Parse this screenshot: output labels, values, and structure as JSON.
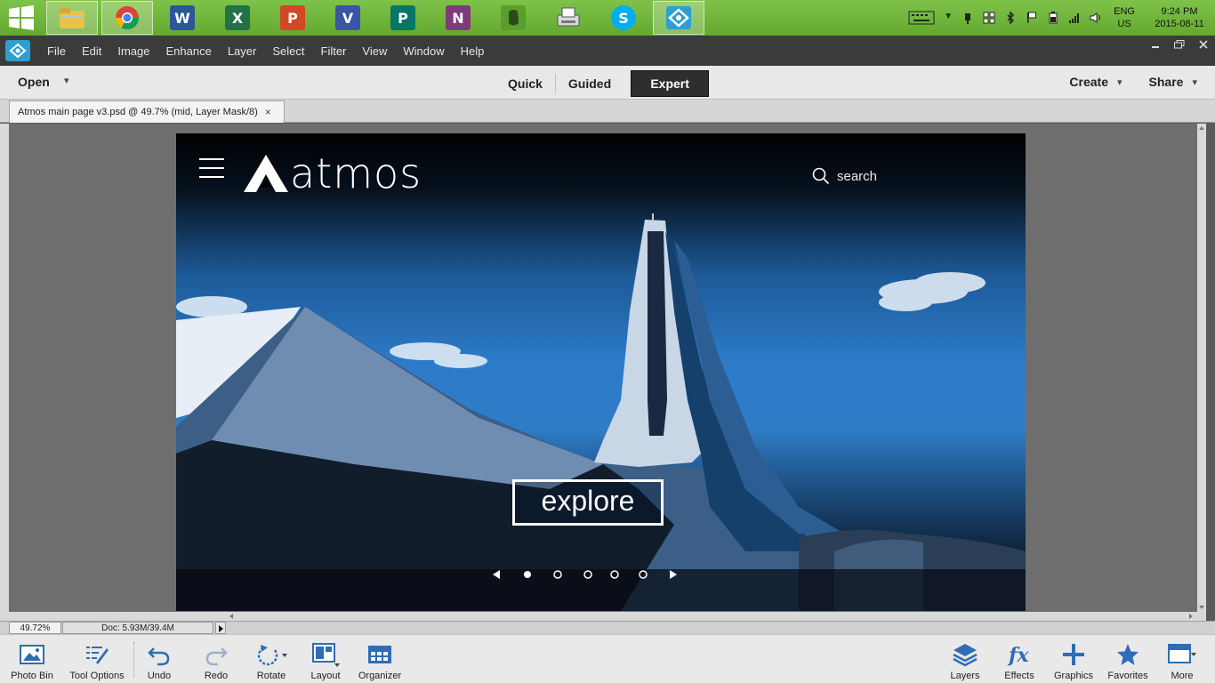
{
  "taskbar": {
    "apps": [
      {
        "name": "file-explorer",
        "letter": "",
        "color": "#e8c34a"
      },
      {
        "name": "chrome",
        "letter": "",
        "color": "#e04b3c"
      },
      {
        "name": "word",
        "letter": "W",
        "color": "#2b579a"
      },
      {
        "name": "excel",
        "letter": "X",
        "color": "#217346"
      },
      {
        "name": "powerpoint",
        "letter": "P",
        "color": "#d24726"
      },
      {
        "name": "visio",
        "letter": "V",
        "color": "#3955a3"
      },
      {
        "name": "publisher",
        "letter": "P",
        "color": "#077568"
      },
      {
        "name": "onenote",
        "letter": "N",
        "color": "#80397b"
      },
      {
        "name": "evernote",
        "letter": "",
        "color": "#6fb536"
      },
      {
        "name": "fax-printer",
        "letter": "",
        "color": "#cfcfcf"
      },
      {
        "name": "skype",
        "letter": "S",
        "color": "#00aff0"
      },
      {
        "name": "photoshop-elements",
        "letter": "",
        "color": "#2d9fd0"
      }
    ],
    "lang": {
      "line1": "ENG",
      "line2": "US"
    },
    "clock": {
      "time": "9:24 PM",
      "date": "2015-08-11"
    }
  },
  "menu": {
    "items": [
      "File",
      "Edit",
      "Image",
      "Enhance",
      "Layer",
      "Select",
      "Filter",
      "View",
      "Window",
      "Help"
    ]
  },
  "modebar": {
    "open_label": "Open",
    "modes": [
      "Quick",
      "Guided",
      "Expert"
    ],
    "active_mode": "Expert",
    "create_label": "Create",
    "share_label": "Share"
  },
  "document": {
    "tab_title": "Atmos main page v3.psd @ 49.7% (mid, Layer Mask/8)",
    "close_glyph": "×"
  },
  "design": {
    "brand": "atmos",
    "search_placeholder": "search",
    "cta_label": "explore",
    "carousel": {
      "total": 5,
      "active_index": 0
    }
  },
  "status": {
    "zoom": "49.72%",
    "doc_size": "Doc: 5.93M/39.4M"
  },
  "bottom_left": [
    {
      "id": "photo-bin",
      "label": "Photo Bin"
    },
    {
      "id": "tool-options",
      "label": "Tool Options"
    },
    {
      "id": "undo",
      "label": "Undo"
    },
    {
      "id": "redo",
      "label": "Redo"
    },
    {
      "id": "rotate",
      "label": "Rotate"
    },
    {
      "id": "layout",
      "label": "Layout"
    },
    {
      "id": "organizer",
      "label": "Organizer"
    }
  ],
  "bottom_right": [
    {
      "id": "layers",
      "label": "Layers"
    },
    {
      "id": "effects",
      "label": "Effects"
    },
    {
      "id": "graphics",
      "label": "Graphics"
    },
    {
      "id": "favorites",
      "label": "Favorites"
    },
    {
      "id": "more",
      "label": "More"
    }
  ],
  "colors": {
    "taskbar": "#6db53a",
    "accent_blue": "#2d9fd0",
    "menubar": "#3b3b3b",
    "icon_blue": "#2f6db5"
  }
}
